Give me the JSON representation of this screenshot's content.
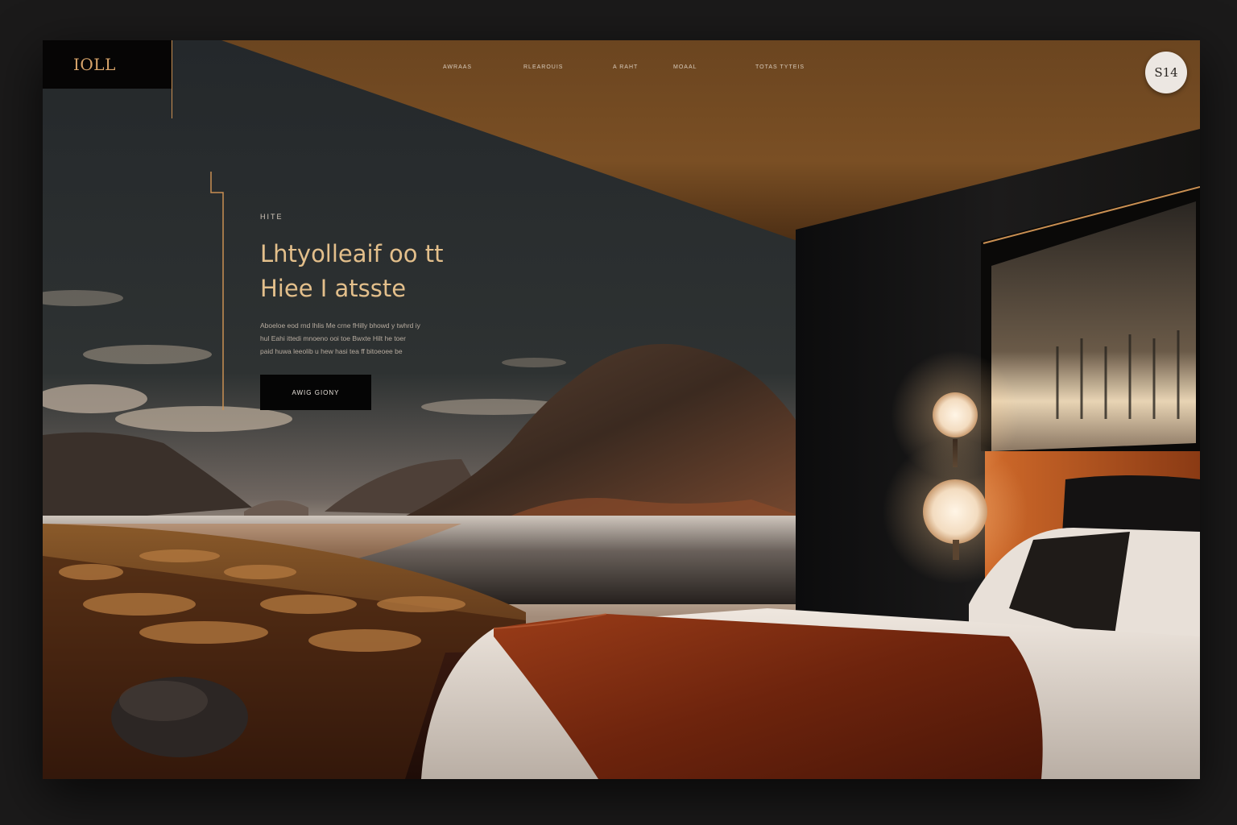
{
  "brand": {
    "logo_text": "IOLL"
  },
  "nav": {
    "items": [
      {
        "label": "AWRAAS"
      },
      {
        "label": "RLEAROUIS"
      },
      {
        "label": "A RAHT"
      },
      {
        "label": "MOAAL"
      },
      {
        "label": "TOTAS TYTEIS"
      }
    ]
  },
  "badge": {
    "text": "S14"
  },
  "hero": {
    "eyebrow": "HITE",
    "headline_line1": "Lhtyolleaif oo tt",
    "headline_line2": "Hiee I atsste",
    "body_line1": "Aboeloe eod rnd lhlis Me crne fHilly bhowd y twhrd iy",
    "body_line2": "hul Eahi ittedi mnoeno ooi toe Bwxte Hilt he toer",
    "body_line3": "paid huwa leeolib u hew hasi tea ff bitoeoee be",
    "cta_label": "AWIG GIONY"
  },
  "colors": {
    "accent": "#c98f52",
    "headline": "#e3bf8b",
    "ceiling": "#7a4d22",
    "headboard": "#c25f24",
    "throw": "#7a2c12"
  },
  "icons": {
    "badge": "circle-badge",
    "accent": "bracket-line-accent"
  }
}
